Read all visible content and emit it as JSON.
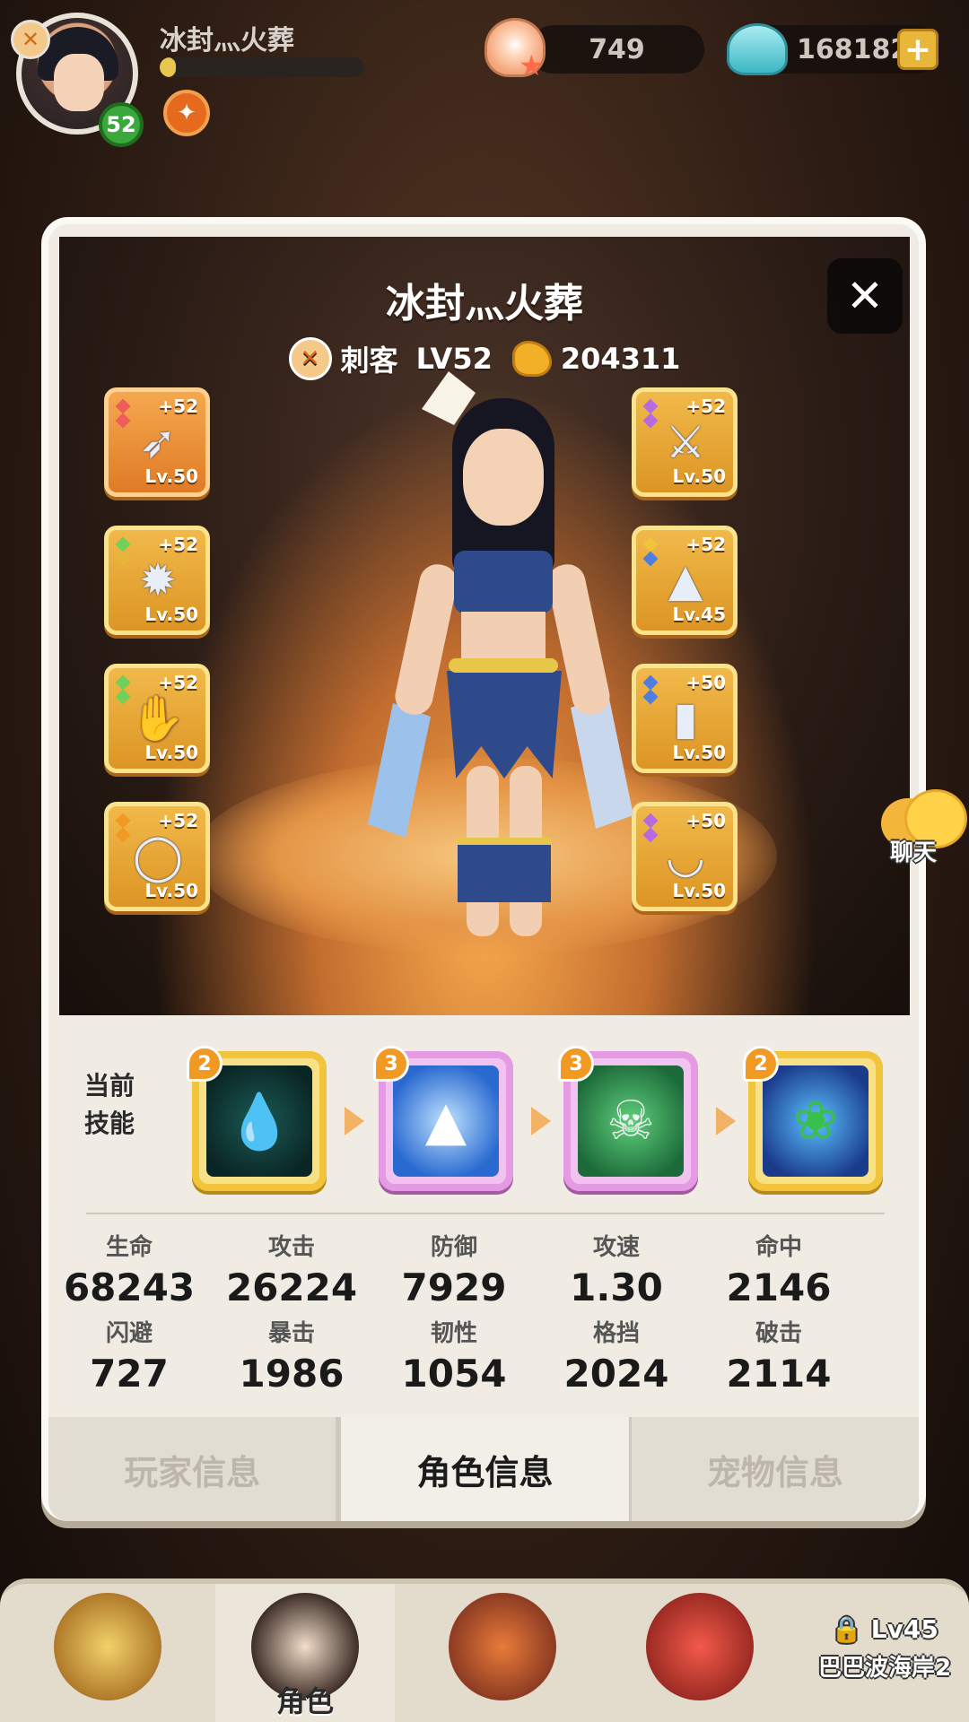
{
  "hud": {
    "player_name": "冰封灬火葬",
    "level": "52",
    "exp_fraction": 0.08,
    "currency_shells": "749",
    "currency_pearls": "168182"
  },
  "panel": {
    "title": "冰封灬火葬",
    "class_name": "刺客",
    "level_text": "LV52",
    "power": "204311",
    "close_symbol": "✕"
  },
  "equipment": {
    "left": [
      {
        "plus": "+52",
        "level": "Lv.50",
        "icon": "spear-icon",
        "gems": [
          "#ef5c5c",
          "#ef5c5c"
        ]
      },
      {
        "plus": "+52",
        "level": "Lv.50",
        "icon": "spiked-armor-icon",
        "gems": [
          "#6fd05a",
          "#e7b53a"
        ]
      },
      {
        "plus": "+52",
        "level": "Lv.50",
        "icon": "claw-gauntlet-icon",
        "gems": [
          "#6fd05a",
          "#6fd05a"
        ]
      },
      {
        "plus": "+52",
        "level": "Lv.50",
        "icon": "ring-icon",
        "gems": [
          "#f09a24",
          "#f09a24"
        ]
      }
    ],
    "right": [
      {
        "plus": "+52",
        "level": "Lv.50",
        "icon": "blade-icon",
        "gems": [
          "#b86be0",
          "#b86be0"
        ]
      },
      {
        "plus": "+52",
        "level": "Lv.45",
        "icon": "hat-icon",
        "gems": [
          "#f0c43a",
          "#4f7de0"
        ]
      },
      {
        "plus": "+50",
        "level": "Lv.50",
        "icon": "boots-icon",
        "gems": [
          "#4f7de0",
          "#4f7de0"
        ]
      },
      {
        "plus": "+50",
        "level": "Lv.50",
        "icon": "necklace-icon",
        "gems": [
          "#b86be0",
          "#b86be0"
        ]
      }
    ]
  },
  "skills": {
    "label_line1": "当前",
    "label_line2": "技能",
    "items": [
      {
        "count": "2",
        "icon": "water-drop-icon"
      },
      {
        "count": "3",
        "icon": "ice-spikes-icon"
      },
      {
        "count": "3",
        "icon": "poison-skull-icon"
      },
      {
        "count": "2",
        "icon": "leaf-creature-icon"
      }
    ]
  },
  "stats": [
    {
      "label": "生命",
      "value": "68243"
    },
    {
      "label": "攻击",
      "value": "26224"
    },
    {
      "label": "防御",
      "value": "7929"
    },
    {
      "label": "攻速",
      "value": "1.30"
    },
    {
      "label": "命中",
      "value": "2146"
    },
    {
      "label": "闪避",
      "value": "727"
    },
    {
      "label": "暴击",
      "value": "1986"
    },
    {
      "label": "韧性",
      "value": "1054"
    },
    {
      "label": "格挡",
      "value": "2024"
    },
    {
      "label": "破击",
      "value": "2114"
    }
  ],
  "tabs": {
    "player_info": "玩家信息",
    "role_info": "角色信息",
    "pet_info": "宠物信息"
  },
  "chat": {
    "label": "聊天"
  },
  "bottom_nav": {
    "role_label": "角色",
    "lock_level": "Lv45",
    "lock_location": "巴巴波海岸2"
  },
  "colors": {
    "equip_gold": "#f1b94a",
    "equip_orange": "#e07a26",
    "skill_gold": "#f1c43b",
    "skill_purple": "#e59be4",
    "level_badge": "#3aa83a"
  }
}
